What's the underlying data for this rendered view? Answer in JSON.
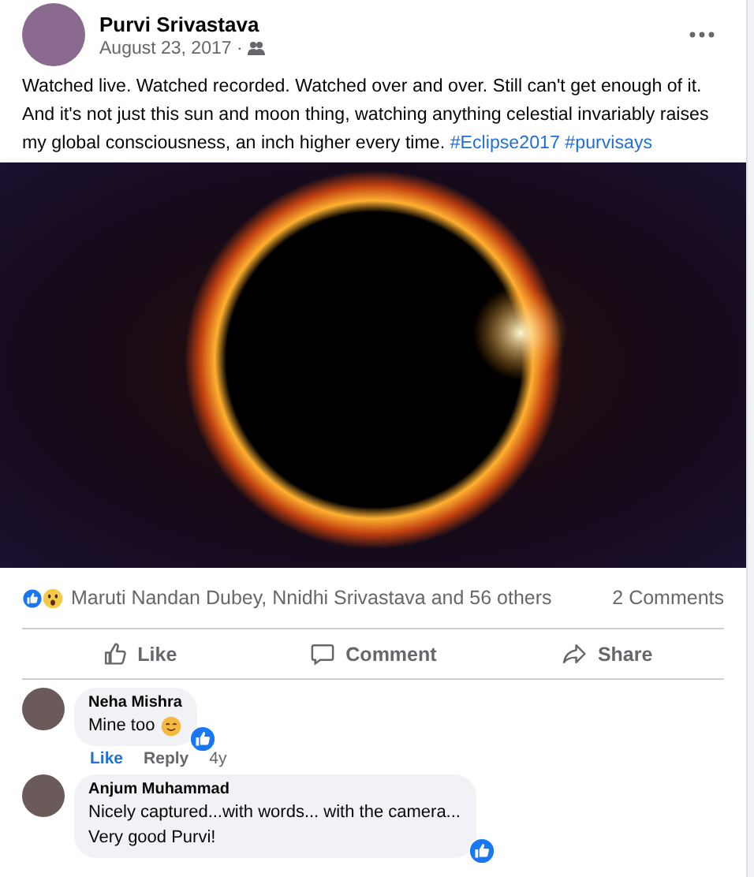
{
  "post": {
    "author": "Purvi Srivastava",
    "date": "August 23, 2017 ·",
    "text": "Watched live. Watched recorded. Watched over and over. Still can't get enough of it. And it's not just this sun and moon thing, watching anything celestial invariably raises my global consciousness, an inch higher every time.",
    "hashtags": [
      "#Eclipse2017",
      "#purvisays"
    ]
  },
  "reactions": {
    "summary": "Maruti Nandan Dubey, Nnidhi Srivastava and 56 others",
    "comments_count": "2 Comments"
  },
  "actions": [
    {
      "kind": "like",
      "label": "Like"
    },
    {
      "kind": "comment",
      "label": "Comment"
    },
    {
      "kind": "share",
      "label": "Share"
    }
  ],
  "comments": [
    {
      "author": "Neha Mishra",
      "text": "Mine too",
      "emoji": true,
      "liked_badge": true,
      "actions": [
        {
          "label": "Like",
          "selected": true
        },
        {
          "label": "Reply",
          "selected": false
        }
      ],
      "time": "4y"
    },
    {
      "author": "Anjum Muhammad",
      "text": "Nicely captured...with words... with the camera...\nVery good Purvi!",
      "emoji": false,
      "liked_badge": true
    }
  ]
}
